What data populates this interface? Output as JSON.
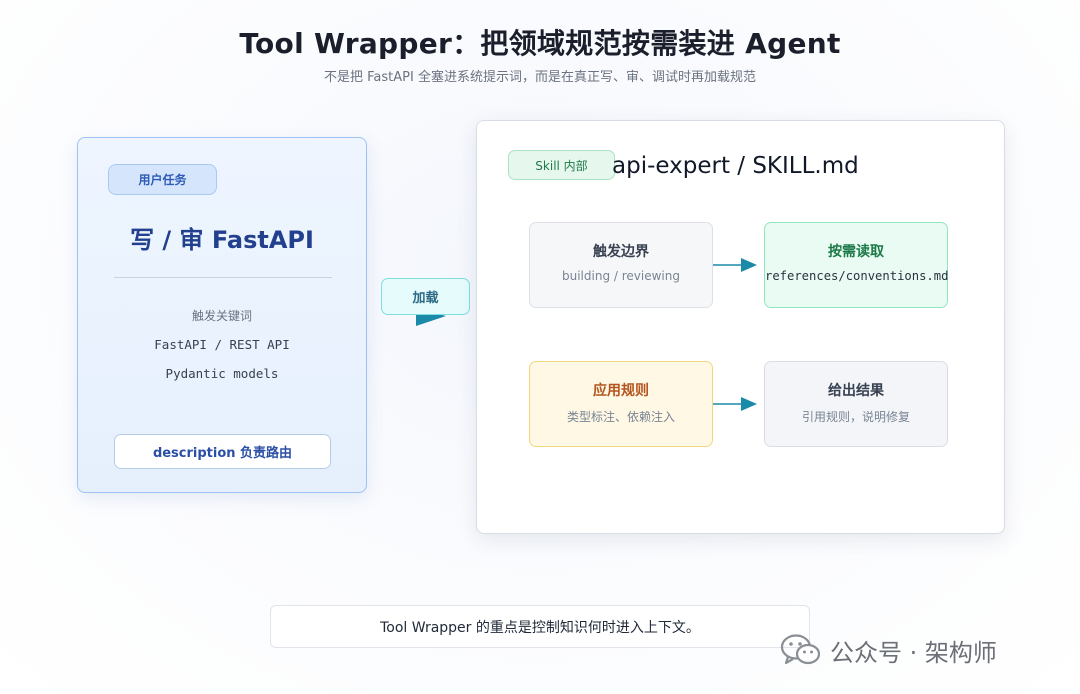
{
  "header": {
    "title": "Tool Wrapper：把领域规范按需装进 Agent",
    "subtitle": "不是把 FastAPI 全塞进系统提示词，而是在真正写、审、调试时再加载规范"
  },
  "left_card": {
    "badge": "用户任务",
    "title": "写 / 审 FastAPI",
    "keywords_label": "触发关键词",
    "keyword_1": "FastAPI / REST API",
    "keyword_2": "Pydantic models",
    "routing_button": "description 负责路由"
  },
  "connector": {
    "label": "加载"
  },
  "right_card": {
    "badge": "Skill 内部",
    "title": "api-expert / SKILL.md",
    "steps": [
      {
        "heading": "触发边界",
        "detail": "building / reviewing"
      },
      {
        "heading": "按需读取",
        "detail": "references/conventions.md"
      },
      {
        "heading": "应用规则",
        "detail": "类型标注、依赖注入"
      },
      {
        "heading": "给出结果",
        "detail": "引用规则，说明修复"
      }
    ]
  },
  "footer": {
    "note": "Tool Wrapper 的重点是控制知识何时进入上下文。"
  },
  "watermark": {
    "text": "公众号 · 架构师",
    "icon": "wechat-icon"
  },
  "colors": {
    "arrow": "#1b8aa8",
    "left_accent": "#23408e",
    "read_step": "#1d7a48",
    "apply_step": "#b4541d"
  }
}
